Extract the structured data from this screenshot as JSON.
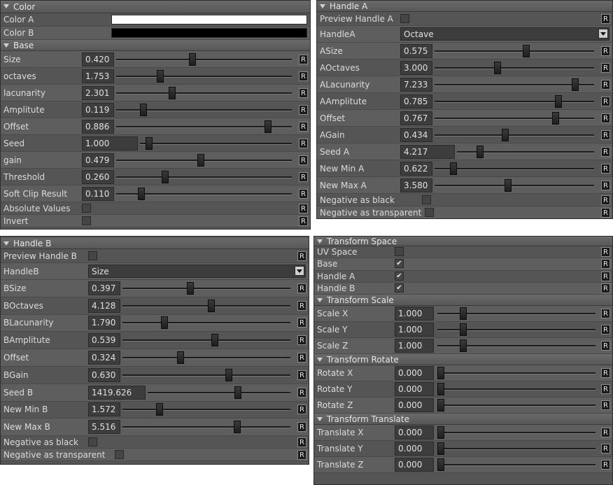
{
  "panel1": {
    "color": {
      "title": "Color",
      "a_label": "Color A",
      "a_color": "#ffffff",
      "b_label": "Color B",
      "b_color": "#000000"
    },
    "base": {
      "title": "Base",
      "sliders": [
        {
          "label": "Size",
          "value": "0.420",
          "pos": 0.43
        },
        {
          "label": "octaves",
          "value": "1.753",
          "pos": 0.24
        },
        {
          "label": "lacunarity",
          "value": "2.301",
          "pos": 0.31
        },
        {
          "label": "Amplitute",
          "value": "0.119",
          "pos": 0.14
        },
        {
          "label": "Offset",
          "value": "0.886",
          "pos": 0.88
        },
        {
          "label": "Seed",
          "value": "1.000",
          "pos": 0.04
        },
        {
          "label": "gain",
          "value": "0.479",
          "pos": 0.48
        },
        {
          "label": "Threshold",
          "value": "0.260",
          "pos": 0.27
        },
        {
          "label": "Soft Clip Result",
          "value": "0.110",
          "pos": 0.13
        }
      ],
      "checks": [
        {
          "label": "Absolute Values",
          "checked": false
        },
        {
          "label": "Invert",
          "checked": false
        }
      ]
    }
  },
  "panel2": {
    "title": "Handle A",
    "preview_label": "Preview Handle A",
    "handle_label": "HandleA",
    "handle_value": "Octave",
    "sliders": [
      {
        "label": "ASize",
        "value": "0.575",
        "pos": 0.58
      },
      {
        "label": "AOctaves",
        "value": "3.000",
        "pos": 0.39
      },
      {
        "label": "ALacunarity",
        "value": "7.233",
        "pos": 0.9
      },
      {
        "label": "AAmplitute",
        "value": "0.785",
        "pos": 0.79
      },
      {
        "label": "Offset",
        "value": "0.767",
        "pos": 0.77
      },
      {
        "label": "AGain",
        "value": "0.434",
        "pos": 0.44
      },
      {
        "label": "Seed A",
        "value": "4.217",
        "pos": 0.15
      },
      {
        "label": "New Min A",
        "value": "0.622",
        "pos": 0.1
      },
      {
        "label": "New Max A",
        "value": "3.580",
        "pos": 0.46
      }
    ],
    "checks": [
      {
        "label": "Negative as black",
        "checked": false
      },
      {
        "label": "Negative as transparent",
        "checked": false
      }
    ]
  },
  "panel3": {
    "title": "Handle B",
    "preview_label": "Preview Handle B",
    "handle_label": "HandleB",
    "handle_value": "Size",
    "sliders": [
      {
        "label": "BSize",
        "value": "0.397",
        "pos": 0.4
      },
      {
        "label": "BOctaves",
        "value": "4.128",
        "pos": 0.53
      },
      {
        "label": "BLacunarity",
        "value": "1.790",
        "pos": 0.24
      },
      {
        "label": "BAmplitute",
        "value": "0.539",
        "pos": 0.55
      },
      {
        "label": "Offset",
        "value": "0.324",
        "pos": 0.34
      },
      {
        "label": "BGain",
        "value": "0.630",
        "pos": 0.64
      },
      {
        "label": "Seed B",
        "value": "1419.626",
        "pos": 0.64
      },
      {
        "label": "New Min B",
        "value": "1.572",
        "pos": 0.21
      },
      {
        "label": "New Max B",
        "value": "5.516",
        "pos": 0.69
      }
    ],
    "checks": [
      {
        "label": "Negative as black",
        "checked": false
      },
      {
        "label": "Negative as transparent",
        "checked": false
      }
    ]
  },
  "panel4": {
    "space": {
      "title": "Transform Space",
      "checks": [
        {
          "label": "UV Space",
          "checked": false
        },
        {
          "label": "Base",
          "checked": true
        },
        {
          "label": "Handle A",
          "checked": true
        },
        {
          "label": "Handle B",
          "checked": true
        }
      ]
    },
    "scale": {
      "title": "Transform Scale",
      "sliders": [
        {
          "label": "Scale X",
          "value": "1.000",
          "pos": 0.15
        },
        {
          "label": "Scale Y",
          "value": "1.000",
          "pos": 0.15
        },
        {
          "label": "Scale Z",
          "value": "1.000",
          "pos": 0.15
        }
      ]
    },
    "rotate": {
      "title": "Transform Rotate",
      "sliders": [
        {
          "label": "Rotate X",
          "value": "0.000",
          "pos": 0.0
        },
        {
          "label": "Rotate Y",
          "value": "0.000",
          "pos": 0.0
        },
        {
          "label": "Rotate Z",
          "value": "0.000",
          "pos": 0.0
        }
      ]
    },
    "translate": {
      "title": "Transform Translate",
      "sliders": [
        {
          "label": "Translate X",
          "value": "0.000",
          "pos": 0.0
        },
        {
          "label": "Translate Y",
          "value": "0.000",
          "pos": 0.0
        },
        {
          "label": "Translate Z",
          "value": "0.000",
          "pos": 0.0
        }
      ]
    }
  },
  "reset_label": "R",
  "check_glyph": "✔"
}
